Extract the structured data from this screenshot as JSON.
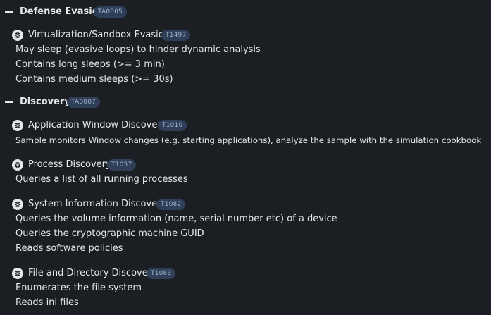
{
  "tactics": [
    {
      "name": "Defense Evasion",
      "id": "TA0005",
      "techniques": [
        {
          "name": "Virtualization/Sandbox Evasion",
          "id": "T1497",
          "descriptions": [
            "May sleep (evasive loops) to hinder dynamic analysis",
            "Contains long sleeps (>= 3 min)",
            "Contains medium sleeps (>= 30s)"
          ]
        }
      ]
    },
    {
      "name": "Discovery",
      "id": "TA0007",
      "techniques": [
        {
          "name": "Application Window Discovery",
          "id": "T1010",
          "descriptions": [
            "Sample monitors Window changes (e.g. starting applications), analyze the sample with the simulation cookbook"
          ]
        },
        {
          "name": "Process Discovery",
          "id": "T1057",
          "descriptions": [
            "Queries a list of all running processes"
          ]
        },
        {
          "name": "System Information Discovery",
          "id": "T1082",
          "descriptions": [
            "Queries the volume information (name, serial number etc) of a device",
            "Queries the cryptographic machine GUID",
            "Reads software policies"
          ]
        },
        {
          "name": "File and Directory Discovery",
          "id": "T1083",
          "descriptions": [
            "Enumerates the file system",
            "Reads ini files"
          ]
        }
      ]
    }
  ],
  "icons": {
    "tactic_toggle": "collapse-dash-icon",
    "technique": "technique-chip-icon"
  },
  "colors": {
    "background": "#1b1e22",
    "text": "#e6e8eb",
    "badge_bg": "#2f3f57",
    "badge_text": "#9fb3cf"
  }
}
